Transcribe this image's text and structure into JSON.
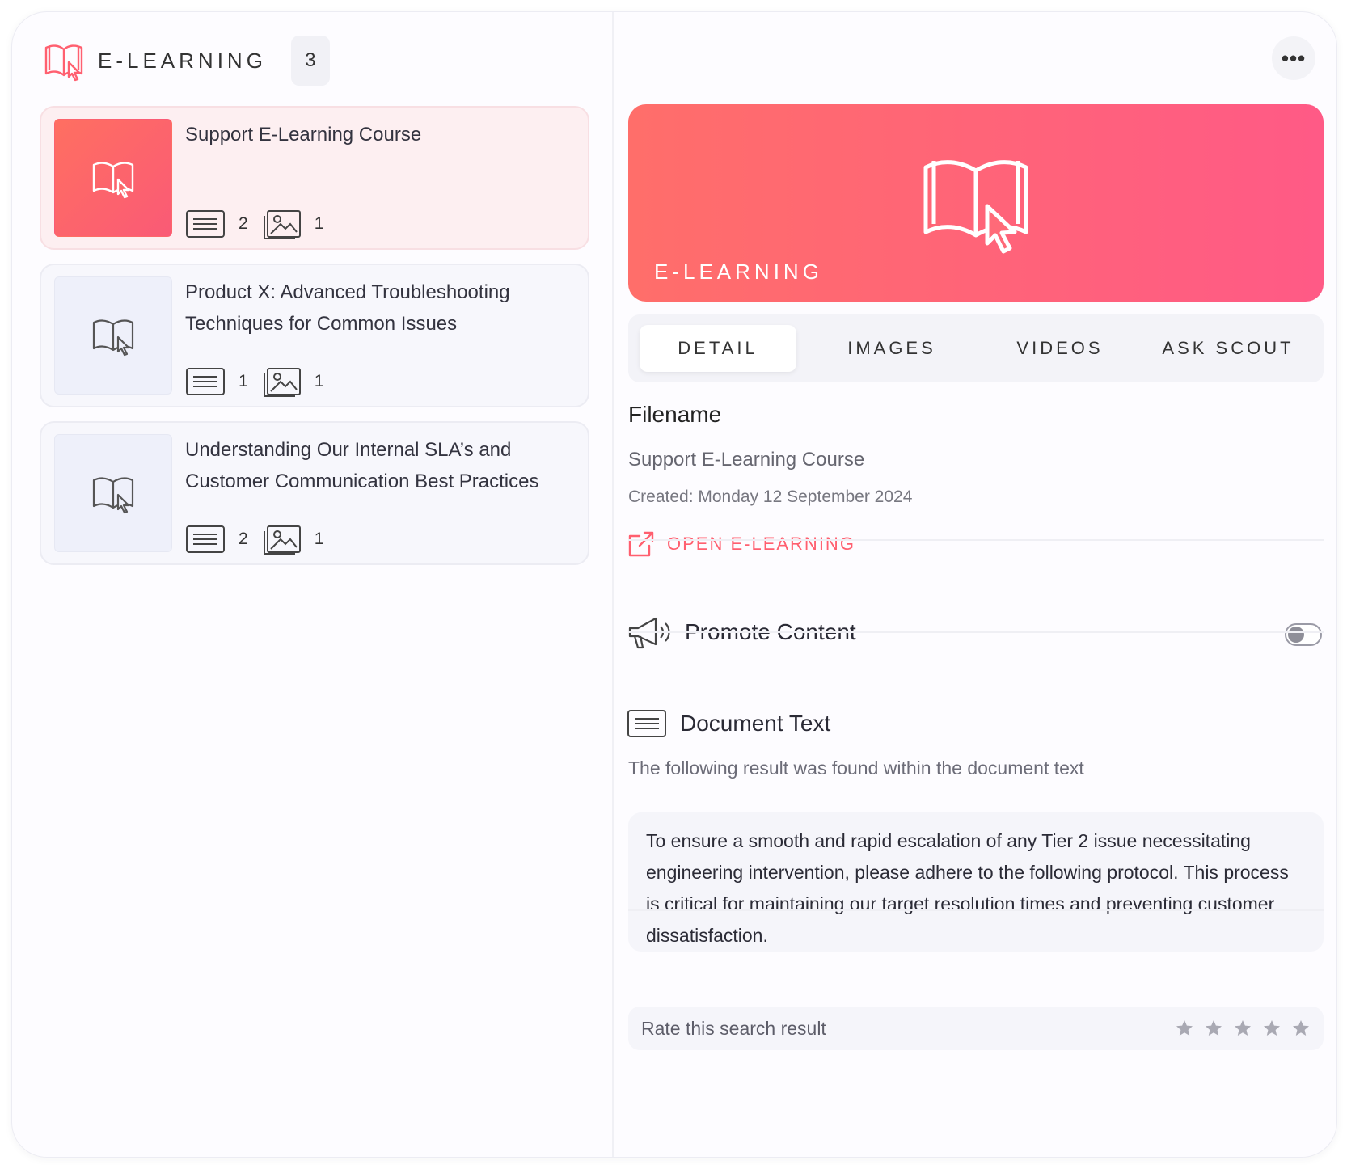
{
  "sidebar": {
    "title": "E-LEARNING",
    "count": "3",
    "items": [
      {
        "name": "Support E-Learning Course",
        "docs": "2",
        "images": "1"
      },
      {
        "name": "Product X: Advanced Troubleshooting Techniques for Common Issues",
        "docs": "1",
        "images": "1"
      },
      {
        "name": "Understanding Our Internal SLA’s and Customer Communication Best Practices",
        "docs": "2",
        "images": "1"
      }
    ]
  },
  "detail": {
    "more_label": "•••",
    "hero_title": "E-LEARNING",
    "tabs": [
      "DETAIL",
      "IMAGES",
      "VIDEOS",
      "ASK SCOUT"
    ],
    "active_tab": "DETAIL",
    "section_label": "Filename",
    "filename": "Support E-Learning Course",
    "created": "Created: Monday 12 September 2024",
    "open_link": "OPEN E-LEARNING",
    "promote_label": "Promote Content",
    "promote_enabled": false,
    "doc_text_title": "Document Text",
    "doc_text_sub": "The following result was found within the document text",
    "doc_text_excerpt": "To ensure a smooth and rapid escalation of any Tier 2 issue necessitating engineering intervention, please adhere to the following protocol. This process is critical for maintaining our target resolution times and preventing customer dissatisfaction.",
    "rate_label": "Rate this search result",
    "rating": 0,
    "rating_max": 5
  },
  "colors": {
    "accent": "#ff5f6f",
    "hero_gradient_start": "#ff6e6a",
    "hero_gradient_end": "#ff5a86",
    "active_item_bg": "#fdeff1"
  }
}
